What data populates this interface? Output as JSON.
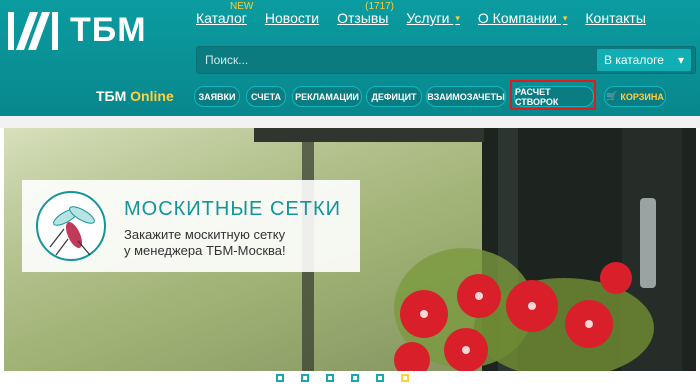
{
  "brand": {
    "logo_text": "ТБМ",
    "online_label_1": "ТБМ",
    "online_label_2": "Online"
  },
  "nav": {
    "items": [
      {
        "label": "Каталог",
        "badge": "NEW"
      },
      {
        "label": "Новости"
      },
      {
        "label": "Отзывы",
        "badge": "(1717)"
      },
      {
        "label": "Услуги"
      },
      {
        "label": "О Компании"
      },
      {
        "label": "Контакты"
      }
    ]
  },
  "search": {
    "placeholder": "Поиск...",
    "button_label": "В каталоге"
  },
  "online_menu": [
    "ЗАЯВКИ",
    "СЧЕТА",
    "РЕКЛАМАЦИИ",
    "ДЕФИЦИТ",
    "ВЗАИМОЗАЧЕТЫ",
    "РАСЧЕТ СТВОРОК",
    "КОРЗИНА"
  ],
  "banner": {
    "title": "МОСКИТНЫЕ СЕТКИ",
    "subtitle_line1": "Закажите москитную сетку",
    "subtitle_line2": "у менеджера ТБМ-Москва!"
  },
  "slider": {
    "count": 6,
    "active_index": 5
  },
  "colors": {
    "header": "#0b9ca1",
    "accent": "#ffd13b",
    "highlight": "#e11b1b",
    "flower": "#d81f2a"
  }
}
